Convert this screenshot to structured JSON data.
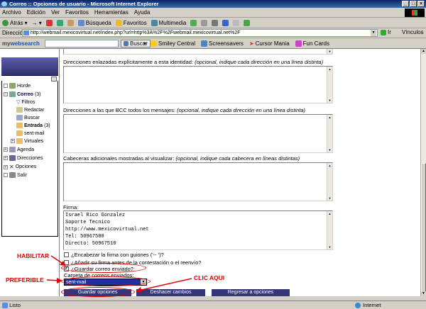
{
  "window": {
    "title": "Correo :: Opciones de usuario - Microsoft Internet Explorer"
  },
  "menu": [
    "Archivo",
    "Edición",
    "Ver",
    "Favoritos",
    "Herramientas",
    "Ayuda"
  ],
  "toolbar": {
    "back": "Atrás",
    "search": "Búsqueda",
    "favorites": "Favoritos",
    "multimedia": "Multimedia"
  },
  "address": {
    "label": "Dirección",
    "url": "http://webmail.mexicovirtual.net/index.php?url=http%3A%2F%2Fwebmail.mexicovirtual.net%2F",
    "go": "Ir",
    "links": "Vínculos"
  },
  "websearch": {
    "logo_a": "my",
    "logo_b": "websearch",
    "search_button": "Buscar",
    "items": [
      "Smiley Central",
      "Screensavers",
      "Cursor Mania",
      "Fun Cards"
    ]
  },
  "sidebar": {
    "horde": "Horde",
    "correo": "Correo",
    "correo_count": "(3)",
    "filtros": "Filtros",
    "redactar": "Redactar",
    "buscar": "Buscar",
    "entrada": "Entrada",
    "entrada_count": "(3)",
    "sentmail": "sent-mail",
    "virtuales": "Virtuales",
    "agenda": "Agenda",
    "direcciones": "Direcciones",
    "opciones": "Opciones",
    "salir": "Salir"
  },
  "form": {
    "linked_label": "Direcciones enlazadas explícitamente a esta identidad:",
    "linked_hint": "(opcional, indique cada dirección en una línea distinta)",
    "bcc_label": "Direcciones a las que BCC todos los mensajes:",
    "bcc_hint": "(opcional, indique cada dirección en una línea distinta)",
    "headers_label": "Cabeceras adicionales mostradas al visualizar:",
    "headers_hint": "(opcional, indique cada cabecera en líneas distintas)",
    "signature_label": "Firma:",
    "signature_lines": [
      "Israel Rico Gonzalez",
      "Soporte Tecnico",
      "http://www.mexicovirtual.net",
      "Tel: 50967500",
      "Directo: 50967510"
    ],
    "cb_dashes": "¿Encabezar la firma con guiones ('-- ')?",
    "cb_sig_before": "¿Añadir su firma antes de la contestación o el reenvío?",
    "cb_save_sent": "¿Guardar correo enviado?",
    "cb_save_sent_checked": true,
    "sent_folder_label": "Carpeta de correos enviados:",
    "sent_folder_value": "sent-mail",
    "btn_save": "Guardar opciones",
    "btn_undo": "Deshacer cambios",
    "btn_back": "Regresar a opciones"
  },
  "annotations": {
    "habilitar": "HABILITAR",
    "preferible": "PREFERIBLE",
    "clic": "CLIC AQUI"
  },
  "status": {
    "left": "Listo",
    "zone": "Internet"
  }
}
